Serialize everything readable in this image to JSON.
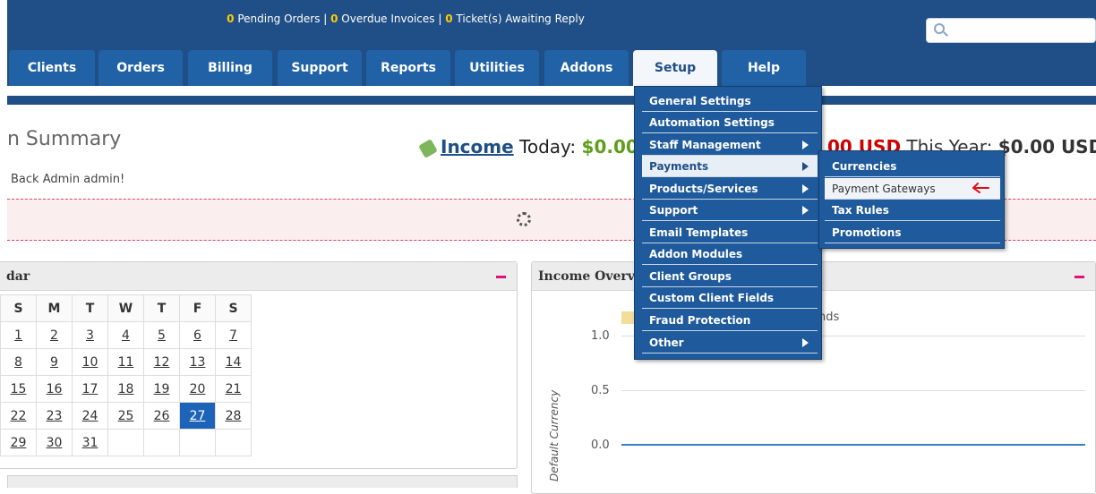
{
  "header": {
    "alerts": {
      "pending_count": "0",
      "pending_label": " Pending Orders | ",
      "overdue_count": "0",
      "overdue_label": " Overdue Invoices | ",
      "tickets_count": "0",
      "tickets_label": " Ticket(s) Awaiting Reply"
    },
    "search": {
      "placeholder": ""
    },
    "tabs": [
      {
        "label": "Clients"
      },
      {
        "label": "Orders"
      },
      {
        "label": "Billing"
      },
      {
        "label": "Support"
      },
      {
        "label": "Reports"
      },
      {
        "label": "Utilities"
      },
      {
        "label": "Addons"
      },
      {
        "label": "Setup",
        "active": true
      },
      {
        "label": "Help"
      }
    ]
  },
  "page": {
    "title": "n Summary",
    "welcome": "Back Admin admin!",
    "income": {
      "label": "Income",
      "today_label": " Today: ",
      "today_value": "$0.00",
      "month_value": "00 USD",
      "year_label": " This Year: ",
      "year_value": "$0.00 USD"
    }
  },
  "calendar": {
    "title": "dar",
    "headers": [
      "S",
      "M",
      "T",
      "W",
      "T",
      "F",
      "S"
    ],
    "weeks": [
      [
        "1",
        "2",
        "3",
        "4",
        "5",
        "6",
        "7"
      ],
      [
        "8",
        "9",
        "10",
        "11",
        "12",
        "13",
        "14"
      ],
      [
        "15",
        "16",
        "17",
        "18",
        "19",
        "20",
        "21"
      ],
      [
        "22",
        "23",
        "24",
        "25",
        "26",
        "27",
        "28"
      ],
      [
        "29",
        "30",
        "31",
        "",
        "",
        "",
        ""
      ]
    ],
    "today": "27"
  },
  "income_overview": {
    "title": "Income Overvie",
    "legend_text": "nds",
    "y_ticks": [
      "1.0",
      "0.5",
      "0.0"
    ],
    "y_label": "Default Currency"
  },
  "setup_menu": {
    "items": [
      {
        "label": "General Settings",
        "submenu": false
      },
      {
        "label": "Automation Settings",
        "submenu": false
      },
      {
        "label": "Staff Management",
        "submenu": true
      },
      {
        "label": "Payments",
        "submenu": true,
        "highlighted": true
      },
      {
        "label": "Products/Services",
        "submenu": true
      },
      {
        "label": "Support",
        "submenu": true
      },
      {
        "label": "Email Templates",
        "submenu": false
      },
      {
        "label": "Addon Modules",
        "submenu": false
      },
      {
        "label": "Client Groups",
        "submenu": false
      },
      {
        "label": "Custom Client Fields",
        "submenu": false
      },
      {
        "label": "Fraud Protection",
        "submenu": false
      },
      {
        "label": "Other",
        "submenu": true
      }
    ]
  },
  "payments_submenu": {
    "items": [
      {
        "label": "Currencies"
      },
      {
        "label": "Payment Gateways",
        "highlighted": true
      },
      {
        "label": "Tax Rules"
      },
      {
        "label": "Promotions"
      }
    ]
  },
  "colors": {
    "header": "#1f4f86",
    "menu": "#1f5a9c",
    "accent_red": "#cc0000",
    "income_green": "#5e9e1a",
    "minus_pink": "#e0127a",
    "today_blue": "#1d63b8"
  }
}
